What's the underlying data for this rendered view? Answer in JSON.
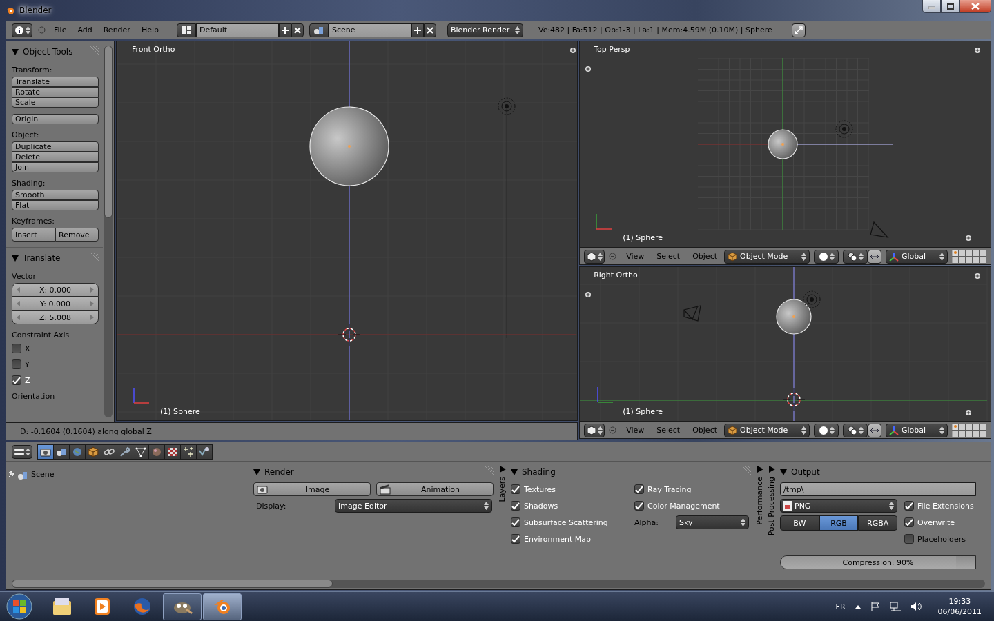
{
  "window": {
    "title": "Blender"
  },
  "info_header": {
    "menus": [
      "File",
      "Add",
      "Render",
      "Help"
    ],
    "screen_layout": "Default",
    "scene": "Scene",
    "render_engine": "Blender Render",
    "stats": "Ve:482 | Fa:512 | Ob:1-3 | La:1 | Mem:4.59M (0.10M) | Sphere"
  },
  "tool_shelf": {
    "title": "Object Tools",
    "expanded": true,
    "groups": [
      {
        "label": "Transform:",
        "kind": "column",
        "buttons": [
          "Translate",
          "Rotate",
          "Scale"
        ]
      },
      {
        "kind": "column",
        "buttons": [
          "Origin"
        ]
      },
      {
        "label": "Object:",
        "kind": "column",
        "buttons": [
          "Duplicate",
          "Delete",
          "Join"
        ]
      },
      {
        "label": "Shading:",
        "kind": "column",
        "buttons": [
          "Smooth",
          "Flat"
        ]
      },
      {
        "label": "Keyframes:",
        "kind": "row",
        "buttons": [
          "Insert",
          "Remove"
        ]
      }
    ]
  },
  "translate_panel": {
    "title": "Translate",
    "expanded": true,
    "vector_label": "Vector",
    "vector": [
      "X: 0.000",
      "Y: 0.000",
      "Z: 5.008"
    ],
    "constraint_label": "Constraint Axis",
    "axes": [
      {
        "label": "X",
        "checked": false
      },
      {
        "label": "Y",
        "checked": false
      },
      {
        "label": "Z",
        "checked": true
      }
    ],
    "orientation_label": "Orientation"
  },
  "operator_status": "D: -0.1604 (0.1604) along global Z",
  "viewports": [
    {
      "kind": "front",
      "title": "Front Ortho",
      "object_label": "(1) Sphere"
    },
    {
      "kind": "top",
      "title": "Top Persp",
      "object_label": "(1) Sphere",
      "header": {
        "menus": [
          "View",
          "Select",
          "Object"
        ],
        "mode": "Object Mode",
        "orientation": "Global"
      }
    },
    {
      "kind": "right",
      "title": "Right Ortho",
      "object_label": "(1) Sphere",
      "header": {
        "menus": [
          "View",
          "Select",
          "Object"
        ],
        "mode": "Object Mode",
        "orientation": "Global"
      }
    }
  ],
  "properties": {
    "tabs": [
      {
        "kind": "render",
        "selected": true
      },
      {
        "kind": "scene",
        "selected": false
      },
      {
        "kind": "world",
        "selected": false
      },
      {
        "kind": "object",
        "selected": false
      },
      {
        "kind": "constraints",
        "selected": false
      },
      {
        "kind": "modifiers",
        "selected": false
      },
      {
        "kind": "mesh",
        "selected": false
      },
      {
        "kind": "material",
        "selected": false
      },
      {
        "kind": "texture",
        "selected": false
      },
      {
        "kind": "particles",
        "selected": false
      },
      {
        "kind": "physics",
        "selected": false
      }
    ],
    "context": "Scene",
    "render": {
      "title": "Render",
      "expanded": true,
      "buttons": [
        "Image",
        "Animation"
      ],
      "display_label": "Display:",
      "display": "Image Editor"
    },
    "left_tabs": [
      {
        "title": "Layers",
        "expanded": false
      }
    ],
    "shading": {
      "title": "Shading",
      "expanded": true,
      "options": [
        {
          "label": "Textures",
          "checked": true
        },
        {
          "label": "Shadows",
          "checked": true
        },
        {
          "label": "Subsurface Scattering",
          "checked": true
        },
        {
          "label": "Environment Map",
          "checked": true
        }
      ],
      "options_right": [
        {
          "label": "Ray Tracing",
          "checked": true
        },
        {
          "label": "Color Management",
          "checked": true
        }
      ],
      "alpha_label": "Alpha:",
      "alpha": "Sky"
    },
    "right_tabs": [
      {
        "title": "Performance",
        "expanded": false
      },
      {
        "title": "Post Processing",
        "expanded": false
      }
    ],
    "output": {
      "title": "Output",
      "expanded": true,
      "path": "/tmp\\",
      "format": "PNG",
      "color_modes": [
        {
          "label": "BW",
          "selected": false
        },
        {
          "label": "RGB",
          "selected": true
        },
        {
          "label": "RGBA",
          "selected": false
        }
      ],
      "options": [
        {
          "label": "File Extensions",
          "checked": true
        },
        {
          "label": "Overwrite",
          "checked": true
        },
        {
          "label": "Placeholders",
          "checked": false
        }
      ],
      "compression": {
        "text": "Compression: 90%",
        "level": 0.9
      }
    }
  },
  "taskbar": {
    "apps": [
      {
        "kind": "explorer",
        "running": false,
        "selected": false
      },
      {
        "kind": "media",
        "running": false,
        "selected": false
      },
      {
        "kind": "firefox",
        "running": false,
        "selected": false
      },
      {
        "kind": "gimp",
        "running": true,
        "selected": false
      },
      {
        "kind": "blender",
        "running": true,
        "selected": true
      }
    ],
    "language": "FR",
    "time": "19:33",
    "date": "06/06/2011"
  }
}
